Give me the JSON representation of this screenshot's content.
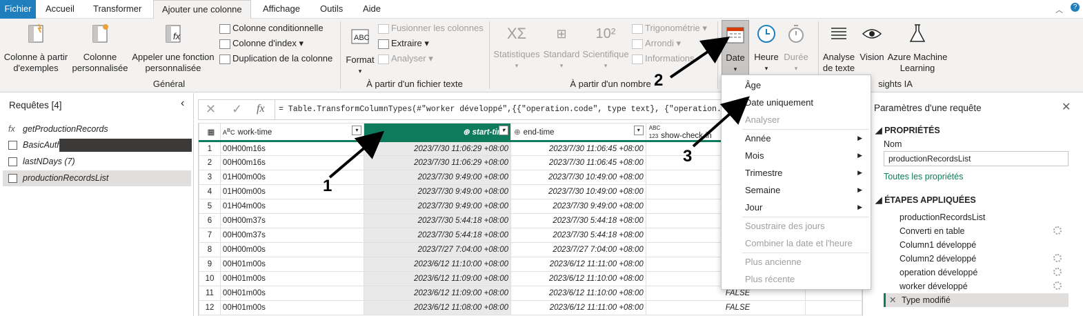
{
  "menubar": {
    "tabs": [
      "Fichier",
      "Accueil",
      "Transformer",
      "Ajouter une colonne",
      "Affichage",
      "Outils",
      "Aide"
    ],
    "active": "Ajouter une colonne"
  },
  "ribbon": {
    "general": {
      "col_from_examples": "Colonne à partir\nd'exemples",
      "custom_col": "Colonne\npersonnalisée",
      "invoke_func": "Appeler une fonction\npersonnalisée",
      "conditional": "Colonne conditionnelle",
      "index": "Colonne d'index",
      "duplicate": "Duplication de la colonne",
      "label": "Général"
    },
    "text": {
      "format": "Format",
      "merge": "Fusionner les colonnes",
      "extract": "Extraire",
      "parse": "Analyser",
      "label": "À partir d'un fichier texte"
    },
    "number": {
      "stats": "Statistiques",
      "standard": "Standard",
      "scientific": "Scientifique",
      "trig": "Trigonométrie",
      "round": "Arrondi",
      "info": "Informations",
      "label": "À partir d'un nombre"
    },
    "datetime": {
      "date": "Date",
      "time": "Heure",
      "duration": "Durée"
    },
    "ai": {
      "text_analytics": "Analyse\nde texte",
      "vision": "Vision",
      "azure_ml": "Azure Machine\nLearning",
      "label": "sights IA"
    }
  },
  "queries": {
    "header": "Requêtes [4]",
    "items": [
      "getProductionRecords",
      "BasicAuth",
      "lastNDays (7)",
      "productionRecordsList"
    ]
  },
  "formula": {
    "text": "= Table.TransformColumnTypes(#\"worker développé\",{{\"operation.code\", type text}, {\"operation.pro"
  },
  "grid": {
    "headers": [
      "work-time",
      "start-time",
      "end-time",
      "show-check-in"
    ],
    "rows": [
      [
        "1",
        "00H00m16s",
        "2023/7/30 11:06:29 +08:00",
        "2023/7/30 11:06:45 +08:00",
        ""
      ],
      [
        "2",
        "00H00m16s",
        "2023/7/30 11:06:29 +08:00",
        "2023/7/30 11:06:45 +08:00",
        ""
      ],
      [
        "3",
        "01H00m00s",
        "2023/7/30 9:49:00 +08:00",
        "2023/7/30 10:49:00 +08:00",
        ""
      ],
      [
        "4",
        "01H00m00s",
        "2023/7/30 9:49:00 +08:00",
        "2023/7/30 10:49:00 +08:00",
        ""
      ],
      [
        "5",
        "01H04m00s",
        "2023/7/30 9:49:00 +08:00",
        "2023/7/30 9:49:00 +08:00",
        ""
      ],
      [
        "6",
        "00H00m37s",
        "2023/7/30 5:44:18 +08:00",
        "2023/7/30 5:44:18 +08:00",
        ""
      ],
      [
        "7",
        "00H00m37s",
        "2023/7/30 5:44:18 +08:00",
        "2023/7/30 5:44:18 +08:00",
        ""
      ],
      [
        "8",
        "00H00m00s",
        "2023/7/27 7:04:00 +08:00",
        "2023/7/27 7:04:00 +08:00",
        ""
      ],
      [
        "9",
        "00H01m00s",
        "2023/6/12 11:10:00 +08:00",
        "2023/6/12 11:11:00 +08:00",
        ""
      ],
      [
        "10",
        "00H01m00s",
        "2023/6/12 11:09:00 +08:00",
        "2023/6/12 11:10:00 +08:00",
        ""
      ],
      [
        "11",
        "00H01m00s",
        "2023/6/12 11:09:00 +08:00",
        "2023/6/12 11:10:00 +08:00",
        "FALSE"
      ],
      [
        "12",
        "00H01m00s",
        "2023/6/12 11:08:00 +08:00",
        "2023/6/12 11:11:00 +08:00",
        "FALSE"
      ]
    ]
  },
  "date_menu": {
    "items": [
      "Âge",
      "Date uniquement",
      "Analyser",
      "Année",
      "Mois",
      "Trimestre",
      "Semaine",
      "Jour",
      "Soustraire des jours",
      "Combiner la date et l'heure",
      "Plus ancienne",
      "Plus récente"
    ]
  },
  "settings": {
    "title": "Paramètres d'une requête",
    "props_header": "PROPRIÉTÉS",
    "name_label": "Nom",
    "name_value": "productionRecordsList",
    "all_props": "Toutes les propriétés",
    "steps_header": "ÉTAPES APPLIQUÉES",
    "steps": [
      "productionRecordsList",
      "Converti en table",
      "Column1 développé",
      "Column2 développé",
      "operation développé",
      "worker développé",
      "Type modifié"
    ]
  },
  "annotations": [
    "1",
    "2",
    "3"
  ]
}
